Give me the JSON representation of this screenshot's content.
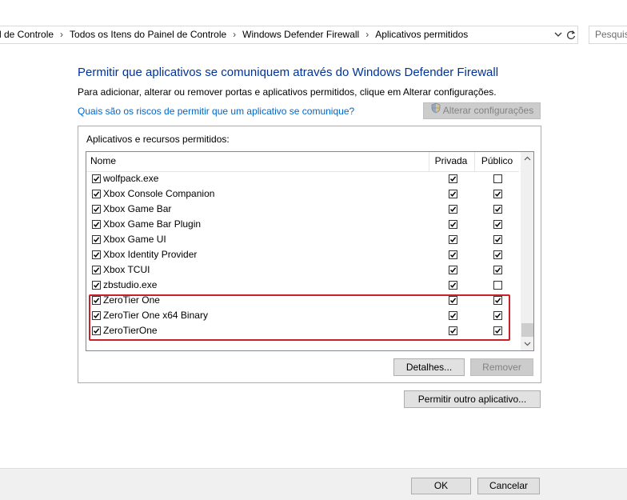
{
  "address_bar": {
    "breadcrumbs": [
      "l de Controle",
      "Todos os Itens do Painel de Controle",
      "Windows Defender Firewall",
      "Aplicativos permitidos"
    ],
    "separator": "›",
    "search_placeholder": "Pesquis"
  },
  "header": {
    "title": "Permitir que aplicativos se comuniquem através do Windows Defender Firewall",
    "description": "Para adicionar, alterar ou remover portas e aplicativos permitidos, clique em Alterar configurações.",
    "risk_link": "Quais são os riscos de permitir que um aplicativo se comunique?",
    "change_settings_label": "Alterar configurações"
  },
  "group": {
    "label": "Aplicativos e recursos permitidos:",
    "columns": [
      "Nome",
      "Privada",
      "Público"
    ],
    "rows": [
      {
        "name": "wolfpack.exe",
        "enabled": true,
        "private": true,
        "public": false
      },
      {
        "name": "Xbox Console Companion",
        "enabled": true,
        "private": true,
        "public": true
      },
      {
        "name": "Xbox Game Bar",
        "enabled": true,
        "private": true,
        "public": true
      },
      {
        "name": "Xbox Game Bar Plugin",
        "enabled": true,
        "private": true,
        "public": true
      },
      {
        "name": "Xbox Game UI",
        "enabled": true,
        "private": true,
        "public": true
      },
      {
        "name": "Xbox Identity Provider",
        "enabled": true,
        "private": true,
        "public": true
      },
      {
        "name": "Xbox TCUI",
        "enabled": true,
        "private": true,
        "public": true
      },
      {
        "name": "zbstudio.exe",
        "enabled": true,
        "private": true,
        "public": false
      },
      {
        "name": "ZeroTier One",
        "enabled": true,
        "private": true,
        "public": true
      },
      {
        "name": "ZeroTier One x64 Binary",
        "enabled": true,
        "private": true,
        "public": true
      },
      {
        "name": "ZeroTierOne",
        "enabled": true,
        "private": true,
        "public": true
      }
    ],
    "details_label": "Detalhes...",
    "remove_label": "Remover"
  },
  "allow_other_label": "Permitir outro aplicativo...",
  "footer": {
    "ok_label": "OK",
    "cancel_label": "Cancelar"
  },
  "colors": {
    "title": "#003399",
    "link": "#0066cc",
    "highlight": "#cc1f2a"
  }
}
